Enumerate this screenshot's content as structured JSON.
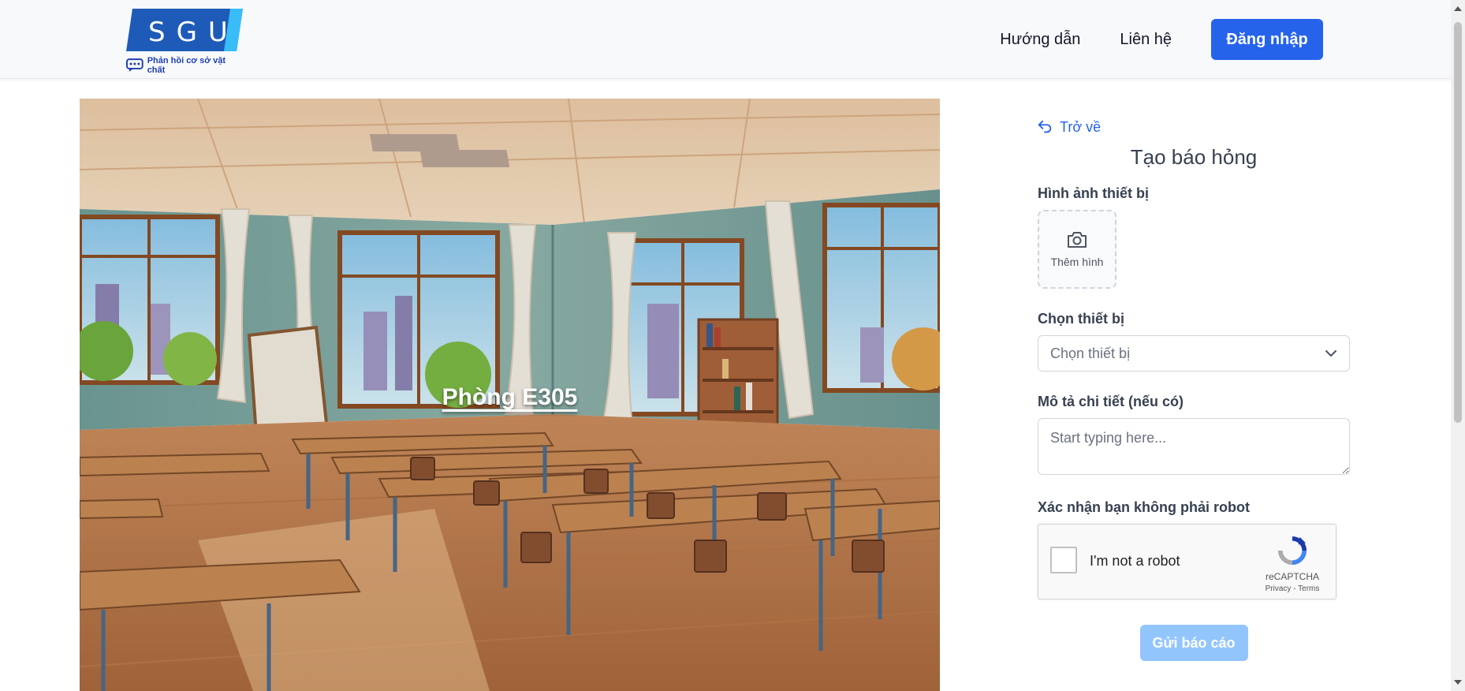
{
  "header": {
    "logo_text": "SGU",
    "logo_tagline": "Phản hồi cơ sở vật chất",
    "nav": [
      {
        "label": "Hướng dẫn"
      },
      {
        "label": "Liên hệ"
      }
    ],
    "login_label": "Đăng nhập"
  },
  "room": {
    "label": "Phòng E305"
  },
  "form": {
    "back_label": "Trở về",
    "title": "Tạo báo hỏng",
    "image_label": "Hình ảnh thiết bị",
    "upload_label": "Thêm hình",
    "device_label": "Chọn thiết bị",
    "device_placeholder": "Chọn thiết bị",
    "description_label": "Mô tả chi tiết (nếu có)",
    "description_placeholder": "Start typing here...",
    "robot_label": "Xác nhận bạn không phải robot",
    "captcha": {
      "text": "I'm not a robot",
      "brand": "reCAPTCHA",
      "links": "Privacy - Terms"
    },
    "submit_label": "Gửi báo cáo"
  },
  "colors": {
    "primary": "#2563eb",
    "submit_disabled": "#93c5fd",
    "logo_blue": "#1e5bb8"
  },
  "icons": {
    "back": "undo-arrow-icon",
    "upload": "camera-icon",
    "select": "chevron-down-icon",
    "captcha": "recaptcha-icon",
    "logo": "chat-bubble-icon"
  }
}
